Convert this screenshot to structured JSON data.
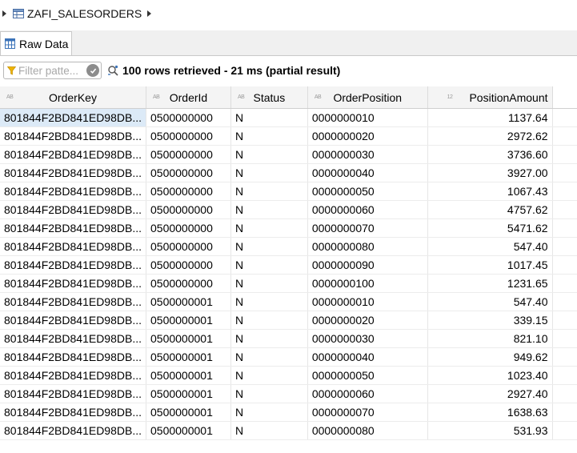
{
  "breadcrumb": {
    "table_name": "ZAFI_SALESORDERS"
  },
  "tabs": [
    {
      "label": "Raw Data"
    }
  ],
  "toolbar": {
    "filter_placeholder": "Filter patte...",
    "status_text": "100 rows retrieved - 21 ms (partial result)"
  },
  "grid": {
    "columns": [
      {
        "name": "OrderKey",
        "type_tag": "AB"
      },
      {
        "name": "OrderId",
        "type_tag": "AB"
      },
      {
        "name": "Status",
        "type_tag": "AB"
      },
      {
        "name": "OrderPosition",
        "type_tag": "AB"
      },
      {
        "name": "PositionAmount",
        "type_tag": "12"
      }
    ],
    "rows": [
      [
        "801844F2BD841ED98DB...",
        "0500000000",
        "N",
        "0000000010",
        "1137.64"
      ],
      [
        "801844F2BD841ED98DB...",
        "0500000000",
        "N",
        "0000000020",
        "2972.62"
      ],
      [
        "801844F2BD841ED98DB...",
        "0500000000",
        "N",
        "0000000030",
        "3736.60"
      ],
      [
        "801844F2BD841ED98DB...",
        "0500000000",
        "N",
        "0000000040",
        "3927.00"
      ],
      [
        "801844F2BD841ED98DB...",
        "0500000000",
        "N",
        "0000000050",
        "1067.43"
      ],
      [
        "801844F2BD841ED98DB...",
        "0500000000",
        "N",
        "0000000060",
        "4757.62"
      ],
      [
        "801844F2BD841ED98DB...",
        "0500000000",
        "N",
        "0000000070",
        "5471.62"
      ],
      [
        "801844F2BD841ED98DB...",
        "0500000000",
        "N",
        "0000000080",
        "547.40"
      ],
      [
        "801844F2BD841ED98DB...",
        "0500000000",
        "N",
        "0000000090",
        "1017.45"
      ],
      [
        "801844F2BD841ED98DB...",
        "0500000000",
        "N",
        "0000000100",
        "1231.65"
      ],
      [
        "801844F2BD841ED98DB...",
        "0500000001",
        "N",
        "0000000010",
        "547.40"
      ],
      [
        "801844F2BD841ED98DB...",
        "0500000001",
        "N",
        "0000000020",
        "339.15"
      ],
      [
        "801844F2BD841ED98DB...",
        "0500000001",
        "N",
        "0000000030",
        "821.10"
      ],
      [
        "801844F2BD841ED98DB...",
        "0500000001",
        "N",
        "0000000040",
        "949.62"
      ],
      [
        "801844F2BD841ED98DB...",
        "0500000001",
        "N",
        "0000000050",
        "1023.40"
      ],
      [
        "801844F2BD841ED98DB...",
        "0500000001",
        "N",
        "0000000060",
        "2927.40"
      ],
      [
        "801844F2BD841ED98DB...",
        "0500000001",
        "N",
        "0000000070",
        "1638.63"
      ],
      [
        "801844F2BD841ED98DB...",
        "0500000001",
        "N",
        "0000000080",
        "531.93"
      ]
    ]
  },
  "icons": {
    "breadcrumb_expand": "chevron-right-icon",
    "table": "table-icon",
    "breadcrumb_next": "chevron-right-icon",
    "tab": "grid-icon",
    "filter": "funnel-icon",
    "clear_filter": "clear-icon",
    "status": "query-status-icon"
  },
  "colors": {
    "selected_cell": "#dceaf7",
    "header_bg": "#f4f4f4",
    "funnel": "#f0b400",
    "table_icon": "#4a6fa5"
  }
}
